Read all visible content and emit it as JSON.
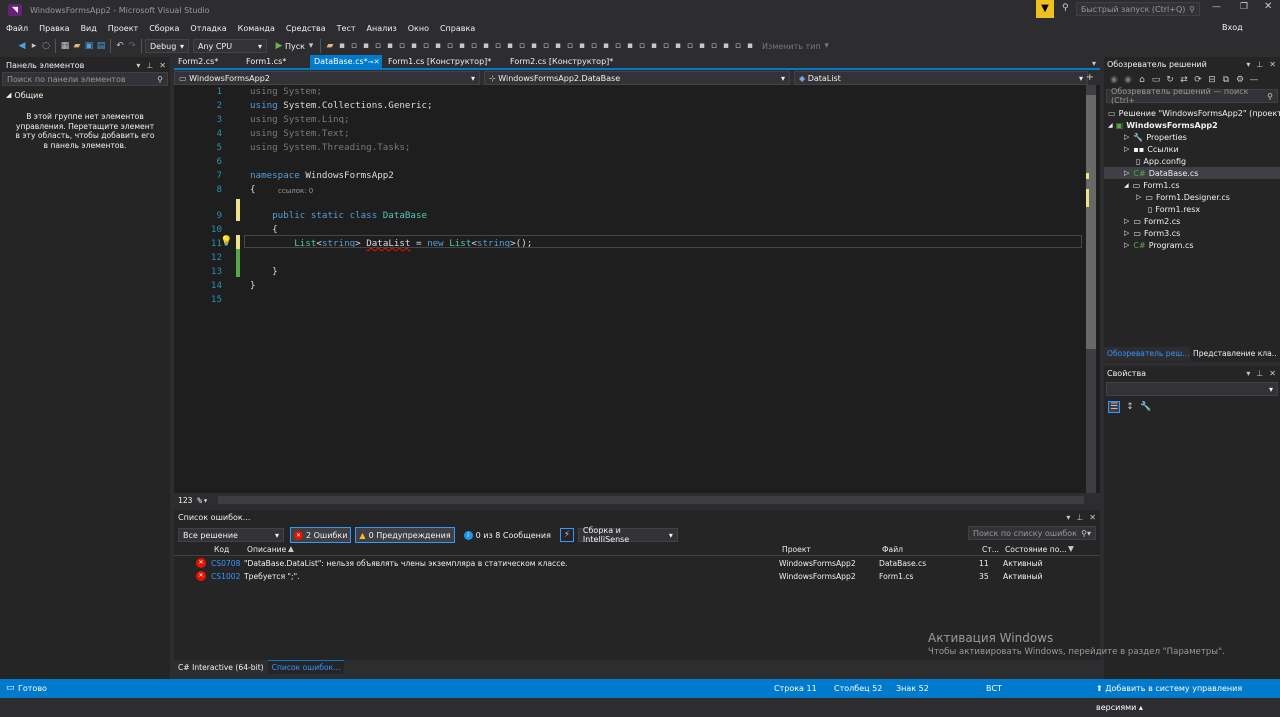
{
  "window": {
    "title": "WindowsFormsApp2 - Microsoft Visual Studio",
    "quick_launch_placeholder": "Быстрый запуск (Ctrl+Q)",
    "signin": "Вход"
  },
  "menu": [
    "Файл",
    "Правка",
    "Вид",
    "Проект",
    "Сборка",
    "Отладка",
    "Команда",
    "Средства",
    "Тест",
    "Анализ",
    "Окно",
    "Справка"
  ],
  "toolbar": {
    "config": "Debug",
    "platform": "Any CPU",
    "start": "Пуск",
    "change_type": "Изменить тип"
  },
  "toolbox": {
    "title": "Панель элементов",
    "search_placeholder": "Поиск по панели элементов",
    "group": "Общие",
    "empty_text": "В этой группе нет элементов управления. Перетащите элемент в эту область, чтобы добавить его в панель элементов."
  },
  "tabs": [
    "Form2.cs*",
    "Form1.cs*",
    "DataBase.cs*",
    "Form1.cs [Конструктор]*",
    "Form2.cs [Конструктор]*"
  ],
  "navbar": {
    "project": "WindowsFormsApp2",
    "class": "WindowsFormsApp2.DataBase",
    "member": "DataList"
  },
  "editor": {
    "zoom": "123 %",
    "codelens": "ссылок: 0",
    "lines": [
      {
        "n": "1",
        "parts": [
          {
            "t": "using ",
            "c": "kw dim"
          },
          {
            "t": "System;",
            "c": "dim"
          }
        ]
      },
      {
        "n": "2",
        "parts": [
          {
            "t": "using ",
            "c": "kw"
          },
          {
            "t": "System.Collections.Generic;",
            "c": ""
          }
        ]
      },
      {
        "n": "3",
        "parts": [
          {
            "t": "using ",
            "c": "kw dim"
          },
          {
            "t": "System.Linq;",
            "c": "dim"
          }
        ]
      },
      {
        "n": "4",
        "parts": [
          {
            "t": "using ",
            "c": "kw dim"
          },
          {
            "t": "System.Text;",
            "c": "dim"
          }
        ]
      },
      {
        "n": "5",
        "parts": [
          {
            "t": "using ",
            "c": "kw dim"
          },
          {
            "t": "System.Threading.Tasks;",
            "c": "dim"
          }
        ]
      },
      {
        "n": "6",
        "parts": []
      },
      {
        "n": "7",
        "parts": [
          {
            "t": "namespace ",
            "c": "kw"
          },
          {
            "t": "WindowsFormsApp2",
            "c": ""
          }
        ]
      },
      {
        "n": "8",
        "parts": [
          {
            "t": "{",
            "c": ""
          }
        ]
      },
      {
        "n": "9",
        "parts": [
          {
            "t": "    public static class ",
            "c": "kw"
          },
          {
            "t": "DataBase",
            "c": "ty"
          }
        ]
      },
      {
        "n": "10",
        "parts": [
          {
            "t": "    {",
            "c": ""
          }
        ]
      },
      {
        "n": "11",
        "parts": [
          {
            "t": "        List",
            "c": "ty"
          },
          {
            "t": "<",
            "c": ""
          },
          {
            "t": "string",
            "c": "kw"
          },
          {
            "t": "> DataList = ",
            "c": ""
          },
          {
            "t": "new ",
            "c": "kw"
          },
          {
            "t": "List",
            "c": "ty"
          },
          {
            "t": "<",
            "c": ""
          },
          {
            "t": "string",
            "c": "kw"
          },
          {
            "t": ">();",
            "c": ""
          }
        ]
      },
      {
        "n": "12",
        "parts": []
      },
      {
        "n": "13",
        "parts": [
          {
            "t": "    }",
            "c": ""
          }
        ]
      },
      {
        "n": "14",
        "parts": [
          {
            "t": "}",
            "c": ""
          }
        ]
      },
      {
        "n": "15",
        "parts": []
      }
    ]
  },
  "error_list": {
    "title": "Список ошибок...",
    "scope": "Все решение",
    "errors_btn": "2 Ошибки",
    "warnings_btn": "0 Предупреждения",
    "messages_btn": "0 из 8 Сообщения",
    "build_filter": "Сборка и IntelliSense",
    "search_placeholder": "Поиск по списку ошибок",
    "columns": [
      "Код",
      "Описание",
      "Проект",
      "Файл",
      "Ст...",
      "Состояние по..."
    ],
    "rows": [
      {
        "code": "CS0708",
        "desc": "\"DataBase.DataList\": нельзя объявлять члены экземпляра в статическом классе.",
        "project": "WindowsFormsApp2",
        "file": "DataBase.cs",
        "line": "11",
        "state": "Активный"
      },
      {
        "code": "CS1002",
        "desc": "Требуется \";\".",
        "project": "WindowsFormsApp2",
        "file": "Form1.cs",
        "line": "35",
        "state": "Активный"
      }
    ],
    "bottom_tabs": [
      "C# Interactive (64-bit)",
      "Список ошибок..."
    ]
  },
  "solution": {
    "title": "Обозреватель решений",
    "search_placeholder": "Обозреватель решений — поиск (Ctrl+",
    "items": [
      {
        "label": "Решение \"WindowsFormsApp2\" (проект:",
        "indent": 0
      },
      {
        "label": "WindowsFormsApp2",
        "indent": 1
      },
      {
        "label": "Properties",
        "indent": 2
      },
      {
        "label": "Ссылки",
        "indent": 2
      },
      {
        "label": "App.config",
        "indent": 2
      },
      {
        "label": "DataBase.cs",
        "indent": 2
      },
      {
        "label": "Form1.cs",
        "indent": 2
      },
      {
        "label": "Form1.Designer.cs",
        "indent": 3
      },
      {
        "label": "Form1.resx",
        "indent": 3
      },
      {
        "label": "Form2.cs",
        "indent": 2
      },
      {
        "label": "Form3.cs",
        "indent": 2
      },
      {
        "label": "Program.cs",
        "indent": 2
      }
    ],
    "bottom_tabs": [
      "Обозреватель реш...",
      "Представление кла..."
    ]
  },
  "properties": {
    "title": "Свойства"
  },
  "watermark": {
    "title": "Активация Windows",
    "text": "Чтобы активировать Windows, перейдите в раздел \"Параметры\"."
  },
  "status": {
    "ready": "Готово",
    "line": "Строка 11",
    "col": "Столбец 52",
    "ch": "Знак 52",
    "ins": "ВСТ",
    "scm": "Добавить в систему управления версиями"
  },
  "colors": {
    "accent": "#007acc",
    "error": "#e51400",
    "bg": "#2d2d30",
    "editor": "#1e1e1e"
  }
}
